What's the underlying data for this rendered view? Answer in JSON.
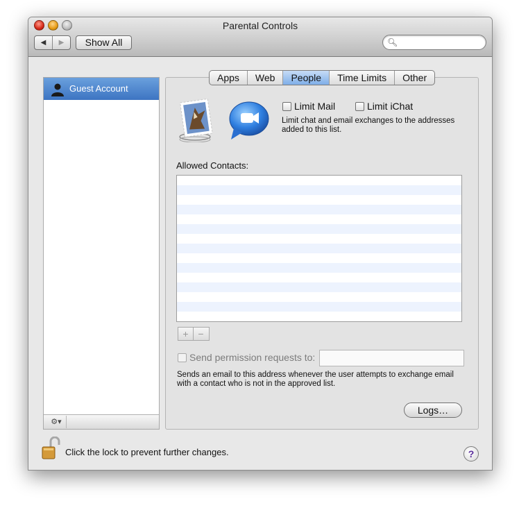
{
  "window": {
    "title": "Parental Controls"
  },
  "toolbar": {
    "back_icon": "◀",
    "forward_icon": "▶",
    "show_all_label": "Show All",
    "search_placeholder": "",
    "search_icon": "magnifier-icon"
  },
  "sidebar": {
    "items": [
      {
        "label": "Guest Account",
        "icon": "user-silhouette-icon"
      }
    ],
    "gear_label": "⚙▾"
  },
  "tabs": [
    {
      "label": "Apps",
      "active": false
    },
    {
      "label": "Web",
      "active": false
    },
    {
      "label": "People",
      "active": true
    },
    {
      "label": "Time Limits",
      "active": false
    },
    {
      "label": "Other",
      "active": false
    }
  ],
  "people": {
    "limit_mail_label": "Limit Mail",
    "limit_ichat_label": "Limit iChat",
    "description": "Limit chat and email exchanges to the addresses added to this list.",
    "allowed_contacts_label": "Allowed Contacts:",
    "contacts": [],
    "add_label": "+",
    "remove_label": "−",
    "permission_label": "Send permission requests to:",
    "permission_value": "",
    "permission_desc": "Sends an email to this address whenever the user attempts to exchange email with a contact who is not in the approved list.",
    "logs_label": "Logs…"
  },
  "footer": {
    "lock_text": "Click the lock to prevent further changes.",
    "help_label": "?"
  },
  "colors": {
    "selection": "#3d74c2",
    "stripe": "#edf3fe",
    "help": "#5a2d9c"
  }
}
